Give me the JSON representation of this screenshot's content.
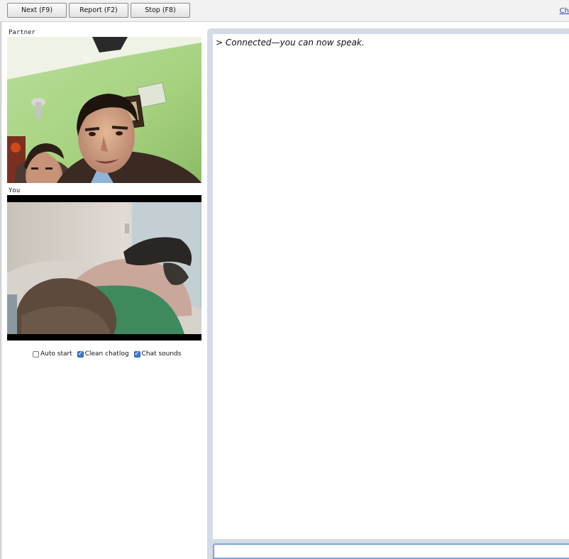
{
  "toolbar": {
    "next_label": "Next (F9)",
    "report_label": "Report (F2)",
    "stop_label": "Stop (F8)",
    "right_link": "Ch"
  },
  "videos": {
    "partner_label": "Partner",
    "you_label": "You"
  },
  "options": {
    "auto_start": {
      "label": "Auto start",
      "checked": false
    },
    "clean_chatlog": {
      "label": "Clean chatlog",
      "checked": true
    },
    "chat_sounds": {
      "label": "Chat sounds",
      "checked": true
    }
  },
  "chat": {
    "messages": [
      {
        "prefix": ">",
        "text": "Connected—you can now speak."
      }
    ],
    "input_value": ""
  },
  "colors": {
    "chat_frame": "#d4dbe6",
    "checkbox_checked": "#3b7bd4",
    "link": "#1a3fb0"
  }
}
